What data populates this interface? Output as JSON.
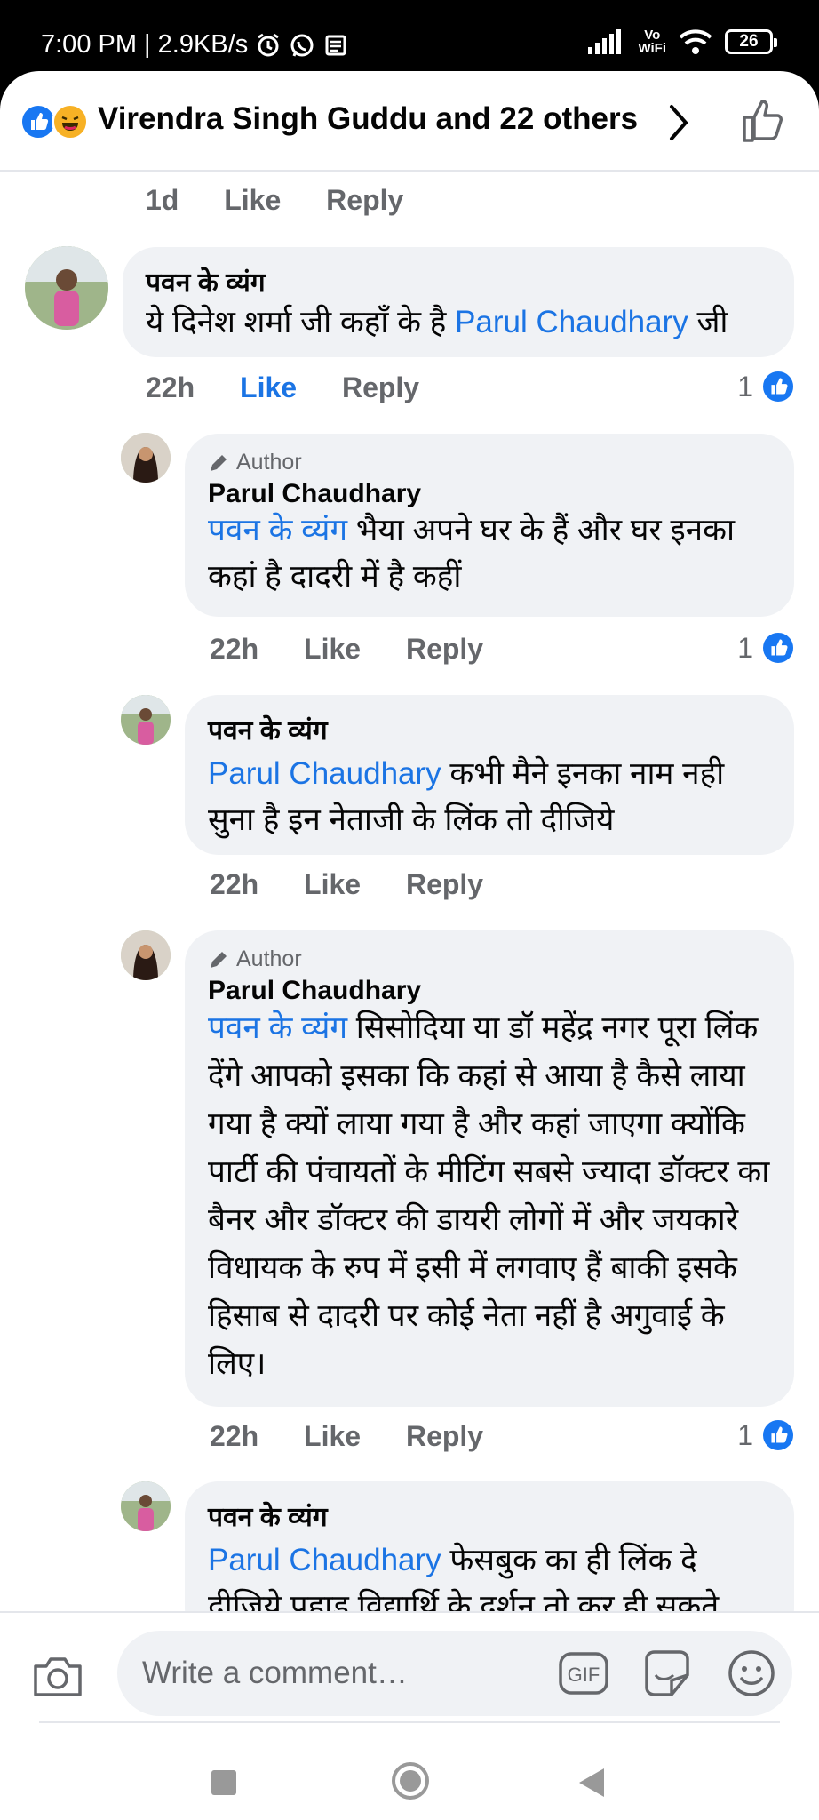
{
  "status_bar": {
    "time_speed": "7:00 PM | 2.9KB/s",
    "vowifi_top": "Vo",
    "vowifi_bottom": "WiFi",
    "battery": "26"
  },
  "header": {
    "title": "Virendra Singh Guddu and 22 others",
    "icons": [
      "like-reaction-icon",
      "haha-reaction-icon",
      "chevron-right-icon",
      "thumbs-up-icon"
    ]
  },
  "thread": {
    "top_meta": {
      "time": "1d",
      "like": "Like",
      "reply": "Reply"
    },
    "comments": [
      {
        "name": "पवन के व्यंग",
        "mention": "",
        "text_before": "ये दिनेश शर्मा जी कहाँ के है ",
        "mention_inline": "Parul Chaudhary",
        "text_after": "  जी",
        "time": "22h",
        "like": "Like",
        "reply": "Reply",
        "reactions": "1"
      },
      {
        "author_tag": "Author",
        "name": "Parul Chaudhary",
        "mention": "पवन के व्यंग",
        "text": " भैया अपने घर के हैं और घर इनका कहां है दादरी में है कहीं",
        "time": "22h",
        "like": "Like",
        "reply": "Reply",
        "reactions": "1"
      },
      {
        "name": "पवन के व्यंग",
        "mention": "Parul Chaudhary",
        "text": " कभी मैने इनका नाम नही सुना है इन नेताजी के लिंक तो दीजिये",
        "time": "22h",
        "like": "Like",
        "reply": "Reply"
      },
      {
        "author_tag": "Author",
        "name": "Parul Chaudhary",
        "mention": "पवन के व्यंग",
        "text": "  सिसोदिया  या डॉ महेंद्र नगर पूरा लिंक देंगे आपको इसका कि कहां से आया है कैसे लाया गया है क्यों लाया गया है और कहां जाएगा क्योंकि  पार्टी की पंचायतों के मीटिंग सबसे ज्यादा डॉक्टर का बैनर और डॉक्टर की डायरी लोगों में और जयकारे विधायक के रुप में इसी में लगवाए हैं बाकी इसके हिसाब से दादरी पर कोई नेता नहीं है अगुवाई के लिए।",
        "time": "22h",
        "like": "Like",
        "reply": "Reply",
        "reactions": "1"
      },
      {
        "name": "पवन के व्यंग",
        "mention": "Parul Chaudhary",
        "text": " फेसबुक का ही लिंक दे दीजिये पहाड़ विद्यार्थि के दर्शन तो कर ही सकते"
      }
    ]
  },
  "composer": {
    "placeholder": "Write a comment…",
    "gif_label": "GIF"
  },
  "colors": {
    "brand_blue": "#1877f2",
    "link_blue": "#1b74e4",
    "bubble_bg": "#f0f2f5",
    "meta_gray": "#65676b"
  }
}
